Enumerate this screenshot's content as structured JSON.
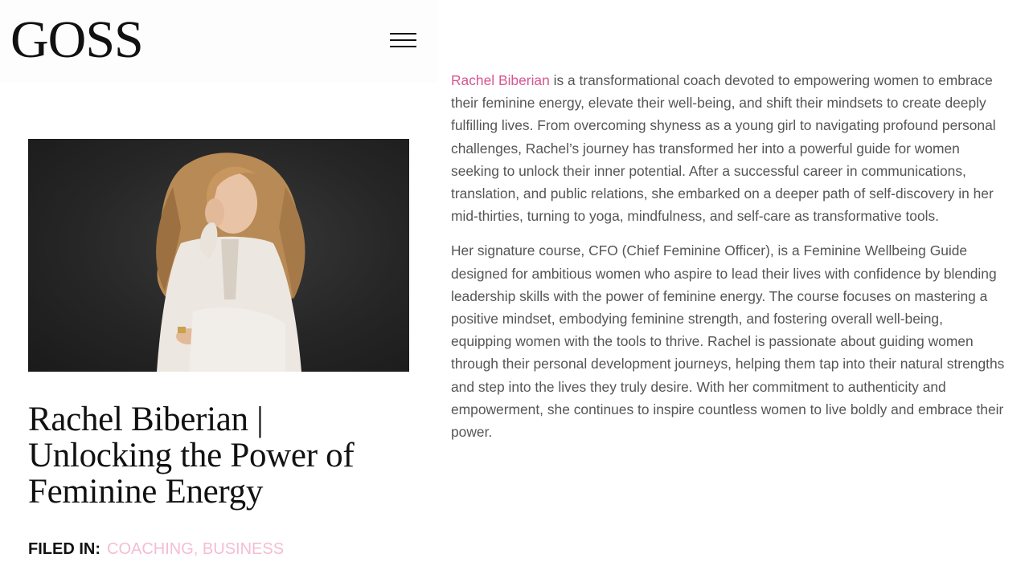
{
  "header": {
    "logo": "GOSS",
    "menu_icon": "hamburger-menu-icon"
  },
  "hero": {
    "image_description_icon": "portrait-photo"
  },
  "post": {
    "title": "Rachel Biberian | Unlocking the Power of Feminine Energy",
    "filed_in_label": "FILED IN:",
    "categories": [
      "COACHING",
      "BUSINESS"
    ],
    "category_separator": ", "
  },
  "article": {
    "author_link": "Rachel Biberian",
    "paragraph1_rest": " is a transformational coach devoted to empowering women to embrace their feminine energy, elevate their well-being, and shift their mindsets to create deeply fulfilling lives. From overcoming shyness as a young girl to navigating profound personal challenges, Rachel’s journey has transformed her into a powerful guide for women seeking to unlock their inner potential. After a successful career in communications, translation, and public relations, she embarked on a deeper path of self-discovery in her mid-thirties, turning to yoga, mindfulness, and self-care as transformative tools.",
    "paragraph2": "Her signature course, CFO (Chief Feminine Officer), is a Feminine Wellbeing Guide designed for ambitious women who aspire to lead their lives with confidence by blending leadership skills with the power of feminine energy. The course focuses on mastering a positive mindset, embodying feminine strength, and fostering overall well-being, equipping women with the tools to thrive. Rachel is passionate about guiding women through their personal development journeys, helping them tap into their natural strengths and step into the lives they truly desire. With her commitment to authenticity and empowerment, she continues to inspire countless women to live boldly and embrace their power."
  },
  "colors": {
    "link_pink": "#d6578f",
    "category_pink": "#f4bdd3",
    "body_text": "#555555",
    "heading": "#111111"
  }
}
